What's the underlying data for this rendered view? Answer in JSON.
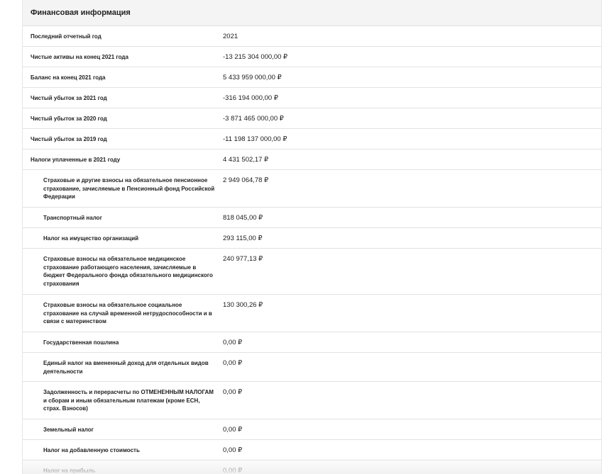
{
  "section": {
    "title": "Финансовая информация"
  },
  "rows": [
    {
      "label": "Последний отчетный год",
      "value": "2021",
      "level": "main"
    },
    {
      "label": "Чистые активы на конец 2021 года",
      "value": "-13 215 304 000,00 ₽",
      "level": "main"
    },
    {
      "label": "Баланс на конец 2021 года",
      "value": "5 433 959 000,00 ₽",
      "level": "main"
    },
    {
      "label": "Чистый убыток за 2021 год",
      "value": "-316 194 000,00 ₽",
      "level": "main"
    },
    {
      "label": "Чистый убыток за 2020 год",
      "value": "-3 871 465 000,00 ₽",
      "level": "main"
    },
    {
      "label": "Чистый убыток за 2019 год",
      "value": "-11 198 137 000,00 ₽",
      "level": "main"
    },
    {
      "label": "Налоги уплаченные в 2021 году",
      "value": "4 431 502,17 ₽",
      "level": "main"
    },
    {
      "label": "Страховые и другие взносы на обязательное пенсионное страхование, зачисляемые в Пенсионный фонд Российской Федерации",
      "value": "2 949 064,78 ₽",
      "level": "sub"
    },
    {
      "label": "Транспортный налог",
      "value": "818 045,00 ₽",
      "level": "sub"
    },
    {
      "label": "Налог на имущество организаций",
      "value": "293 115,00 ₽",
      "level": "sub"
    },
    {
      "label": "Страховые взносы на обязательное медицинское страхование работающего населения, зачисляемые в бюджет Федерального фонда обязательного медицинского страхования",
      "value": "240 977,13 ₽",
      "level": "sub"
    },
    {
      "label": "Страховые взносы на обязательное социальное страхование на случай временной нетрудоспособности и в связи с материнством",
      "value": "130 300,26 ₽",
      "level": "sub"
    },
    {
      "label": "Государственная пошлина",
      "value": "0,00 ₽",
      "level": "sub"
    },
    {
      "label": "Единый налог на вмененный доход для отдельных видов деятельности",
      "value": "0,00 ₽",
      "level": "sub"
    },
    {
      "label": "Задолженность и перерасчеты по ОТМЕНЕННЫМ НАЛОГАМ и сборам и иным обязательным платежам (кроме ЕСН, страх. Взносов)",
      "value": "0,00 ₽",
      "level": "sub"
    },
    {
      "label": "Земельный налог",
      "value": "0,00 ₽",
      "level": "sub"
    },
    {
      "label": "Налог на добавленную стоимость",
      "value": "0,00 ₽",
      "level": "sub"
    },
    {
      "label": "Налог на прибыль",
      "value": "0,00 ₽",
      "level": "sub"
    }
  ]
}
